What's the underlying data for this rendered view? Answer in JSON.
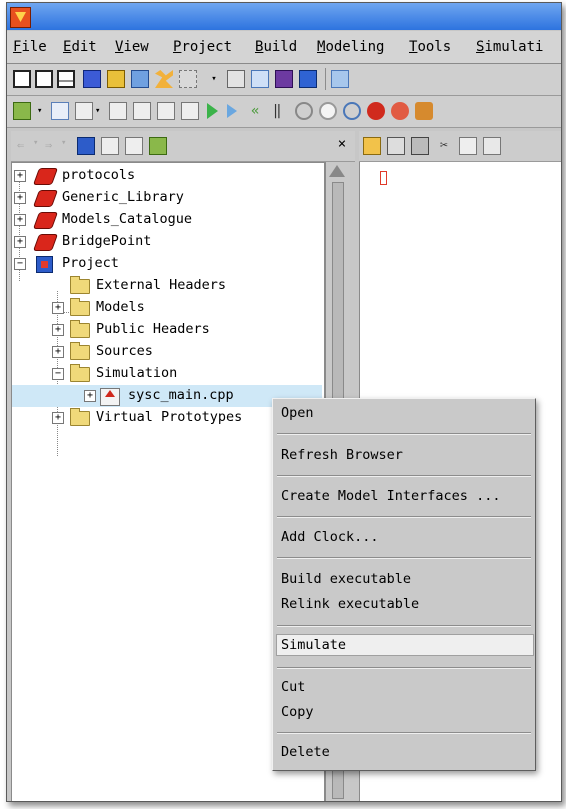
{
  "window": {
    "icon": "app-logo-icon"
  },
  "menubar": {
    "items": [
      {
        "label": "File",
        "mnemonic": "F",
        "rest": "ile"
      },
      {
        "label": "Edit",
        "mnemonic": "E",
        "rest": "dit"
      },
      {
        "label": "View",
        "mnemonic": "V",
        "rest": "iew"
      },
      {
        "label": "Project",
        "mnemonic": "P",
        "rest": "roject"
      },
      {
        "label": "Build",
        "mnemonic": "B",
        "rest": "uild"
      },
      {
        "label": "Modeling",
        "mnemonic": "M",
        "rest": "odeling"
      },
      {
        "label": "Tools",
        "mnemonic": "T",
        "rest": "ools"
      },
      {
        "label": "Simulati",
        "mnemonic": "S",
        "rest": "imulati"
      }
    ]
  },
  "tree": {
    "items": [
      {
        "label": "protocols",
        "icon": "library-icon",
        "expander": "+"
      },
      {
        "label": "Generic_Library",
        "icon": "library-icon",
        "expander": "+"
      },
      {
        "label": "Models_Catalogue",
        "icon": "library-icon",
        "expander": "+"
      },
      {
        "label": "BridgePoint",
        "icon": "library-icon",
        "expander": "+"
      },
      {
        "label": "Project",
        "icon": "project-icon",
        "expander": "−"
      },
      {
        "label": "External Headers",
        "icon": "folder-icon",
        "expander": ""
      },
      {
        "label": "Models",
        "icon": "folder-icon",
        "expander": "+"
      },
      {
        "label": "Public Headers",
        "icon": "folder-icon",
        "expander": "+"
      },
      {
        "label": "Sources",
        "icon": "folder-icon",
        "expander": "+"
      },
      {
        "label": "Simulation",
        "icon": "folder-icon",
        "expander": "−"
      },
      {
        "label": "sysc_main.cpp",
        "icon": "main-file-icon",
        "expander": "+"
      },
      {
        "label": "Virtual Prototypes",
        "icon": "folder-icon",
        "expander": "+"
      }
    ],
    "selected": "sysc_main.cpp"
  },
  "pane": {
    "close_label": "×"
  },
  "context_menu": {
    "items": [
      "Open",
      "Refresh Browser",
      "Create Model Interfaces ...",
      "Add Clock...",
      "Build executable",
      "Relink executable",
      "Simulate",
      "Cut",
      "Copy",
      "Delete"
    ],
    "highlighted": "Simulate"
  },
  "colors": {
    "titlebar": "#3b7fe5",
    "selection": "#cfe8f7",
    "menu_bg": "#c9c9c9"
  }
}
